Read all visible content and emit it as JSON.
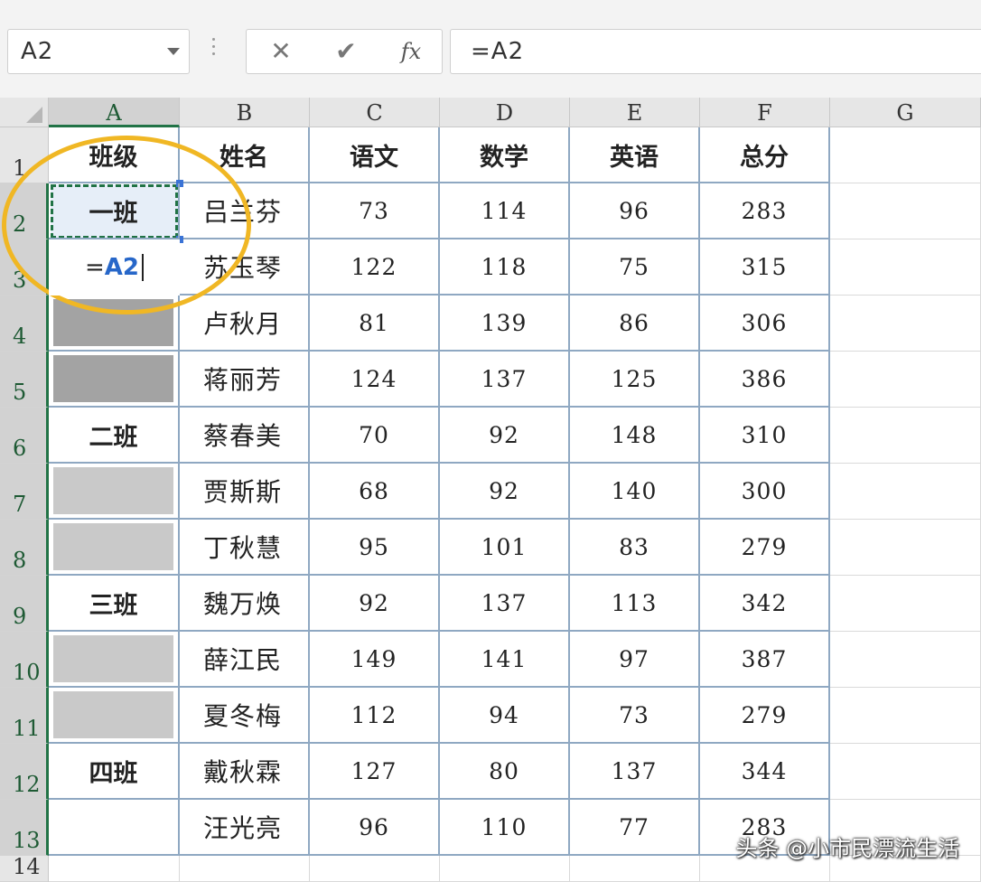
{
  "formula_bar": {
    "name_box": "A2",
    "cancel_icon": "✕",
    "enter_icon": "✔",
    "function_label": "fx",
    "formula": "=A2"
  },
  "columns": [
    "A",
    "B",
    "C",
    "D",
    "E",
    "F",
    "G"
  ],
  "rows": [
    "1",
    "2",
    "3",
    "4",
    "5",
    "6",
    "7",
    "8",
    "9",
    "10",
    "11",
    "12",
    "13",
    "14"
  ],
  "table": {
    "headers": [
      "班级",
      "姓名",
      "语文",
      "数学",
      "英语",
      "总分"
    ],
    "class_cells": [
      "一班",
      "",
      "",
      "",
      "二班",
      "",
      "",
      "三班",
      "",
      "",
      "四班",
      ""
    ],
    "records": [
      [
        "吕兰芬",
        "73",
        "114",
        "96",
        "283"
      ],
      [
        "苏玉琴",
        "122",
        "118",
        "75",
        "315"
      ],
      [
        "卢秋月",
        "81",
        "139",
        "86",
        "306"
      ],
      [
        "蒋丽芳",
        "124",
        "137",
        "125",
        "386"
      ],
      [
        "蔡春美",
        "70",
        "92",
        "148",
        "310"
      ],
      [
        "贾斯斯",
        "68",
        "92",
        "140",
        "300"
      ],
      [
        "丁秋慧",
        "95",
        "101",
        "83",
        "279"
      ],
      [
        "魏万焕",
        "92",
        "137",
        "113",
        "342"
      ],
      [
        "薛江民",
        "149",
        "141",
        "97",
        "387"
      ],
      [
        "夏冬梅",
        "112",
        "94",
        "73",
        "279"
      ],
      [
        "戴秋霖",
        "127",
        "80",
        "137",
        "344"
      ],
      [
        "汪光亮",
        "96",
        "110",
        "77",
        "283"
      ]
    ]
  },
  "editing_cell": {
    "prefix": "=",
    "ref": "A2"
  },
  "colors": {
    "accent": "#217346",
    "highlight": "#f0b724",
    "ref": "#2767c9"
  },
  "watermark": "头条 @小市民漂流生活"
}
